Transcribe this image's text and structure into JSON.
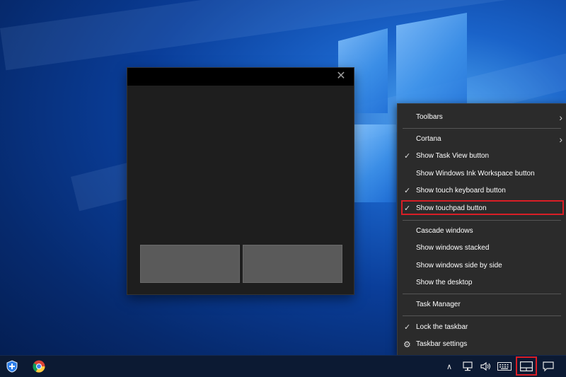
{
  "touchpad_window": {
    "close_glyph": "✕"
  },
  "context_menu": {
    "items": [
      {
        "label": "Toolbars",
        "checked": false,
        "submenu": true
      },
      {
        "label": "Cortana",
        "checked": false,
        "submenu": true
      },
      {
        "label": "Show Task View button",
        "checked": true,
        "submenu": false
      },
      {
        "label": "Show Windows Ink Workspace button",
        "checked": false,
        "submenu": false
      },
      {
        "label": "Show touch keyboard button",
        "checked": true,
        "submenu": false
      },
      {
        "label": "Show touchpad button",
        "checked": true,
        "submenu": false,
        "highlighted": true
      },
      {
        "label": "Cascade windows",
        "checked": false,
        "submenu": false
      },
      {
        "label": "Show windows stacked",
        "checked": false,
        "submenu": false
      },
      {
        "label": "Show windows side by side",
        "checked": false,
        "submenu": false
      },
      {
        "label": "Show the desktop",
        "checked": false,
        "submenu": false
      },
      {
        "label": "Task Manager",
        "checked": false,
        "submenu": false
      },
      {
        "label": "Lock the taskbar",
        "checked": true,
        "submenu": false
      },
      {
        "label": "Taskbar settings",
        "checked": false,
        "submenu": false,
        "icon": "gear-icon"
      }
    ],
    "check_glyph": "✓",
    "submenu_glyph": "›",
    "gear_glyph": "⚙"
  },
  "taskbar": {
    "icons": [
      "shield-icon",
      "chrome-icon",
      "chevron-up-icon",
      "network-icon",
      "volume-icon",
      "keyboard-icon",
      "touchpad-icon",
      "notification-icon"
    ],
    "caret_glyph": "∧"
  },
  "colors": {
    "highlight_box": "#d91e26",
    "menu_bg": "#2b2b2b",
    "taskbar_bg": "#0c1a33"
  }
}
